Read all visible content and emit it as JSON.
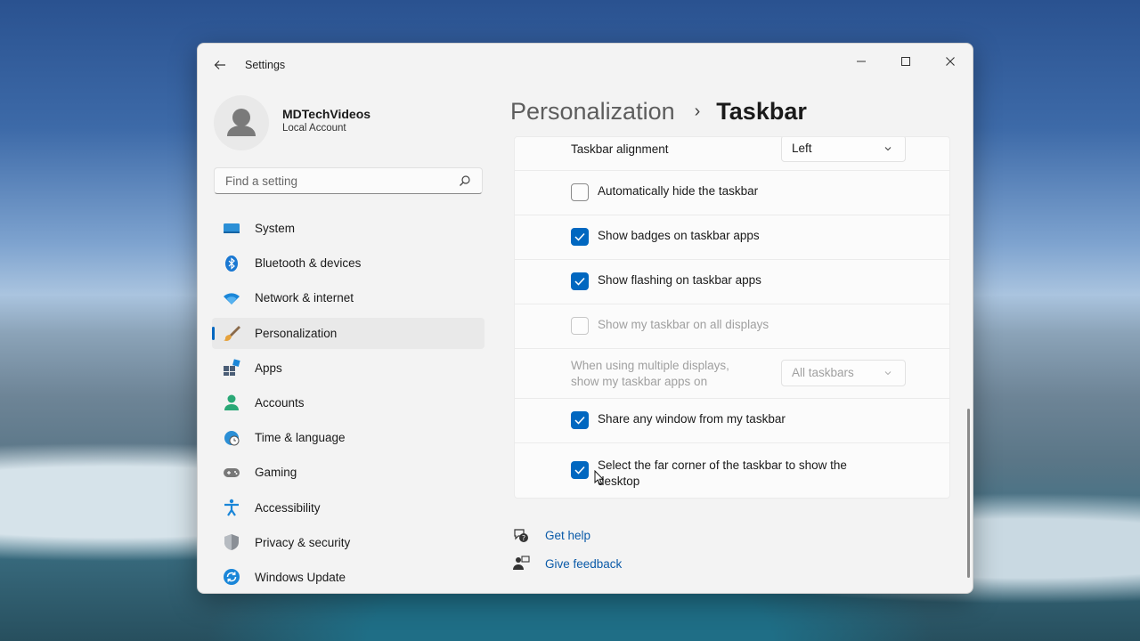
{
  "window": {
    "title": "Settings"
  },
  "profile": {
    "name": "MDTechVideos",
    "account_type": "Local Account"
  },
  "search": {
    "placeholder": "Find a setting"
  },
  "sidebar": {
    "items": [
      {
        "label": "System",
        "icon": "system-icon",
        "active": false
      },
      {
        "label": "Bluetooth & devices",
        "icon": "bluetooth-icon",
        "active": false
      },
      {
        "label": "Network & internet",
        "icon": "wifi-icon",
        "active": false
      },
      {
        "label": "Personalization",
        "icon": "paintbrush-icon",
        "active": true
      },
      {
        "label": "Apps",
        "icon": "apps-icon",
        "active": false
      },
      {
        "label": "Accounts",
        "icon": "person-icon",
        "active": false
      },
      {
        "label": "Time & language",
        "icon": "globe-clock-icon",
        "active": false
      },
      {
        "label": "Gaming",
        "icon": "gamepad-icon",
        "active": false
      },
      {
        "label": "Accessibility",
        "icon": "accessibility-icon",
        "active": false
      },
      {
        "label": "Privacy & security",
        "icon": "shield-icon",
        "active": false
      },
      {
        "label": "Windows Update",
        "icon": "update-icon",
        "active": false
      }
    ]
  },
  "breadcrumb": {
    "parent": "Personalization",
    "separator": "›",
    "current": "Taskbar"
  },
  "settings": {
    "alignment": {
      "label": "Taskbar alignment",
      "value": "Left"
    },
    "auto_hide": {
      "label": "Automatically hide the taskbar",
      "checked": false
    },
    "badges": {
      "label": "Show badges on taskbar apps",
      "checked": true
    },
    "flashing": {
      "label": "Show flashing on taskbar apps",
      "checked": true
    },
    "all_displays": {
      "label": "Show my taskbar on all displays",
      "checked": false,
      "disabled": true
    },
    "multi_display": {
      "label_line1": "When using multiple displays,",
      "label_line2": "show my taskbar apps on",
      "value": "All taskbars",
      "disabled": true
    },
    "share_window": {
      "label": "Share any window from my taskbar",
      "checked": true
    },
    "far_corner": {
      "label_line1": "Select the far corner of the taskbar to show the",
      "label_line2": "desktop",
      "checked": true
    }
  },
  "help": {
    "get_help": "Get help",
    "give_feedback": "Give feedback"
  },
  "colors": {
    "accent": "#0067c0",
    "link": "#0a5aa8"
  }
}
